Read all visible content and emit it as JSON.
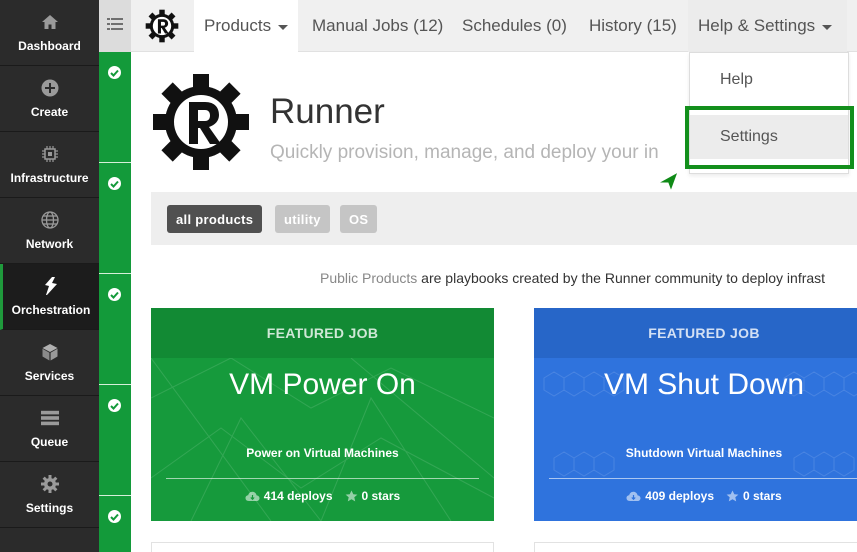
{
  "nav": {
    "items": [
      {
        "label": "Dashboard",
        "icon": "home-icon"
      },
      {
        "label": "Create",
        "icon": "plus-circle-icon"
      },
      {
        "label": "Infrastructure",
        "icon": "chip-icon"
      },
      {
        "label": "Network",
        "icon": "globe-icon"
      },
      {
        "label": "Orchestration",
        "icon": "orchestration-icon"
      },
      {
        "label": "Services",
        "icon": "cube-icon"
      },
      {
        "label": "Queue",
        "icon": "queue-icon"
      },
      {
        "label": "Settings",
        "icon": "gear-icon"
      }
    ],
    "active": "Orchestration"
  },
  "topbar": {
    "tabs": [
      {
        "label": "Products",
        "has_caret": true
      },
      {
        "label": "Manual Jobs (12)",
        "has_caret": false
      },
      {
        "label": "Schedules (0)",
        "has_caret": false
      },
      {
        "label": "History (15)",
        "has_caret": false
      },
      {
        "label": "Help & Settings",
        "has_caret": true
      }
    ]
  },
  "hero": {
    "title": "Runner",
    "subtitle": "Quickly provision, manage, and deploy your in"
  },
  "filters": [
    "all products",
    "utility",
    "OS"
  ],
  "intro": {
    "link": "Public Products",
    "text": " are playbooks created by the Runner community to deploy infrast"
  },
  "cards": [
    {
      "header": "FEATURED JOB",
      "title": "VM Power On",
      "description": "Power on Virtual Machines",
      "deploys": "414 deploys",
      "stars": "0 stars",
      "color": "#169a3c"
    },
    {
      "header": "FEATURED JOB",
      "title": "VM Shut Down",
      "description": "Shutdown Virtual Machines",
      "deploys": "409 deploys",
      "stars": "0 stars",
      "color": "#2f73dd"
    }
  ],
  "dropdown": {
    "items": [
      "Help",
      "Settings"
    ],
    "highlighted": "Settings"
  },
  "colors": {
    "accent_green": "#139a3a",
    "highlight_border": "#138f1c",
    "nav_bg": "#2b2b2b"
  }
}
